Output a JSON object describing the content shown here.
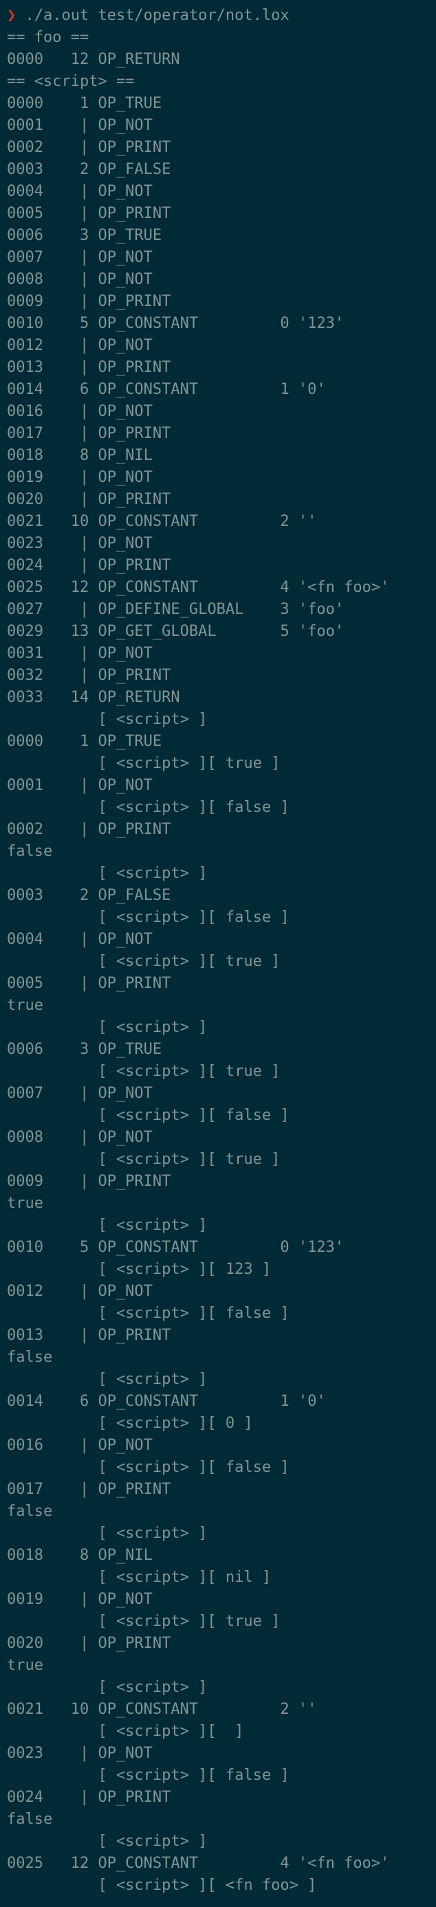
{
  "prompt": {
    "symbol": "❯",
    "command": " ./a.out test/operator/not.lox"
  },
  "lines": [
    "== foo ==",
    "0000   12 OP_RETURN",
    "== <script> ==",
    "0000    1 OP_TRUE",
    "0001    | OP_NOT",
    "0002    | OP_PRINT",
    "0003    2 OP_FALSE",
    "0004    | OP_NOT",
    "0005    | OP_PRINT",
    "0006    3 OP_TRUE",
    "0007    | OP_NOT",
    "0008    | OP_NOT",
    "0009    | OP_PRINT",
    "0010    5 OP_CONSTANT         0 '123'",
    "0012    | OP_NOT",
    "0013    | OP_PRINT",
    "0014    6 OP_CONSTANT         1 '0'",
    "0016    | OP_NOT",
    "0017    | OP_PRINT",
    "0018    8 OP_NIL",
    "0019    | OP_NOT",
    "0020    | OP_PRINT",
    "0021   10 OP_CONSTANT         2 ''",
    "0023    | OP_NOT",
    "0024    | OP_PRINT",
    "0025   12 OP_CONSTANT         4 '<fn foo>'",
    "0027    | OP_DEFINE_GLOBAL    3 'foo'",
    "0029   13 OP_GET_GLOBAL       5 'foo'",
    "0031    | OP_NOT",
    "0032    | OP_PRINT",
    "0033   14 OP_RETURN",
    "          [ <script> ]",
    "0000    1 OP_TRUE",
    "          [ <script> ][ true ]",
    "0001    | OP_NOT",
    "          [ <script> ][ false ]",
    "0002    | OP_PRINT",
    "false",
    "          [ <script> ]",
    "0003    2 OP_FALSE",
    "          [ <script> ][ false ]",
    "0004    | OP_NOT",
    "          [ <script> ][ true ]",
    "0005    | OP_PRINT",
    "true",
    "          [ <script> ]",
    "0006    3 OP_TRUE",
    "          [ <script> ][ true ]",
    "0007    | OP_NOT",
    "          [ <script> ][ false ]",
    "0008    | OP_NOT",
    "          [ <script> ][ true ]",
    "0009    | OP_PRINT",
    "true",
    "          [ <script> ]",
    "0010    5 OP_CONSTANT         0 '123'",
    "          [ <script> ][ 123 ]",
    "0012    | OP_NOT",
    "          [ <script> ][ false ]",
    "0013    | OP_PRINT",
    "false",
    "          [ <script> ]",
    "0014    6 OP_CONSTANT         1 '0'",
    "          [ <script> ][ 0 ]",
    "0016    | OP_NOT",
    "          [ <script> ][ false ]",
    "0017    | OP_PRINT",
    "false",
    "          [ <script> ]",
    "0018    8 OP_NIL",
    "          [ <script> ][ nil ]",
    "0019    | OP_NOT",
    "          [ <script> ][ true ]",
    "0020    | OP_PRINT",
    "true",
    "          [ <script> ]",
    "0021   10 OP_CONSTANT         2 ''",
    "          [ <script> ][  ]",
    "0023    | OP_NOT",
    "          [ <script> ][ false ]",
    "0024    | OP_PRINT",
    "false",
    "          [ <script> ]",
    "0025   12 OP_CONSTANT         4 '<fn foo>'",
    "          [ <script> ][ <fn foo> ]"
  ],
  "colors": {
    "background": "#002b36",
    "text": "#839496",
    "prompt_symbol": "#dc322f"
  }
}
